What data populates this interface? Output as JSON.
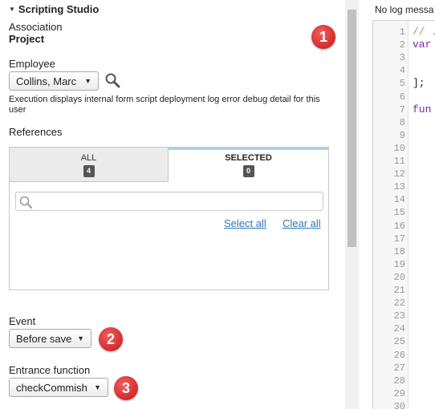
{
  "header": {
    "title": "Scripting Studio"
  },
  "association": {
    "label": "Association",
    "value": "Project"
  },
  "employee": {
    "label": "Employee",
    "selected": "Collins, Marc",
    "help": "Execution displays internal form script deployment log error debug detail for this user"
  },
  "references": {
    "label": "References",
    "tabs": [
      {
        "label": "ALL",
        "count": "4"
      },
      {
        "label": "SELECTED",
        "count": "0"
      }
    ],
    "search_placeholder": "",
    "select_all": "Select all",
    "clear_all": "Clear all"
  },
  "event": {
    "label": "Event",
    "selected": "Before save"
  },
  "entrance": {
    "label": "Entrance function",
    "selected": "checkCommish"
  },
  "callouts": [
    "1",
    "2",
    "3"
  ],
  "log": {
    "message": "No log messa"
  },
  "editor": {
    "lines": [
      {
        "n": "1",
        "code": "// ."
      },
      {
        "n": "2",
        "code": "var"
      },
      {
        "n": "3",
        "code": ""
      },
      {
        "n": "4",
        "code": ""
      },
      {
        "n": "5",
        "code": "];"
      },
      {
        "n": "6",
        "code": ""
      },
      {
        "n": "7",
        "code": "fun"
      },
      {
        "n": "8",
        "code": ""
      },
      {
        "n": "9",
        "code": ""
      },
      {
        "n": "10",
        "code": ""
      },
      {
        "n": "11",
        "code": ""
      },
      {
        "n": "12",
        "code": ""
      },
      {
        "n": "13",
        "code": ""
      },
      {
        "n": "14",
        "code": ""
      },
      {
        "n": "15",
        "code": ""
      },
      {
        "n": "16",
        "code": ""
      },
      {
        "n": "17",
        "code": ""
      },
      {
        "n": "18",
        "code": ""
      },
      {
        "n": "19",
        "code": ""
      },
      {
        "n": "20",
        "code": ""
      },
      {
        "n": "21",
        "code": ""
      },
      {
        "n": "22",
        "code": ""
      },
      {
        "n": "23",
        "code": ""
      },
      {
        "n": "24",
        "code": ""
      },
      {
        "n": "25",
        "code": ""
      },
      {
        "n": "26",
        "code": ""
      },
      {
        "n": "27",
        "code": ""
      },
      {
        "n": "28",
        "code": ""
      },
      {
        "n": "29",
        "code": ""
      },
      {
        "n": "30",
        "code": ""
      }
    ]
  },
  "colors": {
    "callout": "#d42a2a",
    "link": "#2b78b8",
    "selected_tab_accent": "#a7d3ea",
    "comment": "#a0a05a",
    "keyword": "#7a2a9a"
  }
}
